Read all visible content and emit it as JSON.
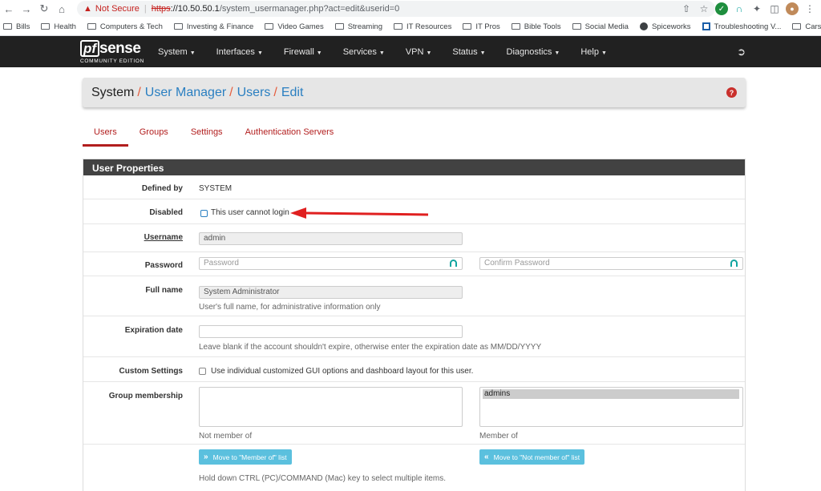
{
  "browser": {
    "warning": "Not Secure",
    "url_scheme": "https",
    "url_rest": "://10.50.50.1",
    "url_path": "/system_usermanager.php?act=edit&userid=0",
    "bookmarks": [
      "Bills",
      "Health",
      "Computers & Tech",
      "Investing & Finance",
      "Video Games",
      "Streaming",
      "IT Resources",
      "IT Pros",
      "Bible Tools",
      "Social Media",
      "Spiceworks",
      "Troubleshooting V...",
      "Cars"
    ]
  },
  "nav": {
    "logo_pf": "pf",
    "logo_sense": "sense",
    "logo_ce": "COMMUNITY EDITION",
    "menu": [
      "System",
      "Interfaces",
      "Firewall",
      "Services",
      "VPN",
      "Status",
      "Diagnostics",
      "Help"
    ]
  },
  "breadcrumb": {
    "system": "System",
    "user_manager": "User Manager",
    "users": "Users",
    "edit": "Edit"
  },
  "tabs": [
    "Users",
    "Groups",
    "Settings",
    "Authentication Servers"
  ],
  "panel": {
    "title": "User Properties",
    "defined_by_label": "Defined by",
    "defined_by_value": "SYSTEM",
    "disabled_label": "Disabled",
    "disabled_text": "This user cannot login",
    "username_label": "Username",
    "username_value": "admin",
    "password_label": "Password",
    "password_placeholder": "Password",
    "confirm_placeholder": "Confirm Password",
    "fullname_label": "Full name",
    "fullname_value": "System Administrator",
    "fullname_help": "User's full name, for administrative information only",
    "expiration_label": "Expiration date",
    "expiration_help": "Leave blank if the account shouldn't expire, otherwise enter the expiration date as MM/DD/YYYY",
    "custom_label": "Custom Settings",
    "custom_text": "Use individual customized GUI options and dashboard layout for this user.",
    "group_label": "Group membership",
    "member_of_option": "admins",
    "not_member_caption": "Not member of",
    "member_caption": "Member of",
    "move_to_member_btn": "Move to \"Member of\" list",
    "move_to_not_member_btn": "Move to \"Not member of\" list",
    "multi_select_help": "Hold down CTRL (PC)/COMMAND (Mac) key to select multiple items."
  },
  "colors": {
    "navbar": "#212121",
    "accent_red": "#b21e1e",
    "link_blue": "#2a7fc1",
    "info_button": "#5bc0de",
    "annotation_arrow": "#e02020"
  }
}
